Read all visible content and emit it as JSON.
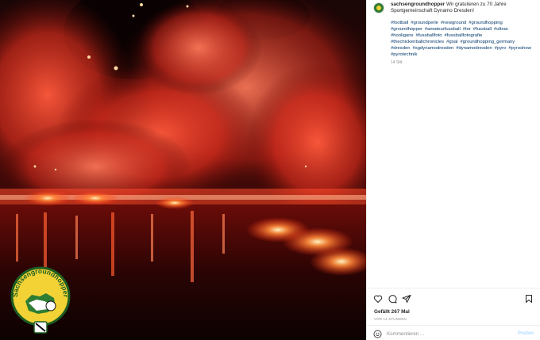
{
  "post": {
    "username": "sachsengroundhopper",
    "caption": "Wir gratulieren zu 70 Jahre Sportgemeinschaft Dynamo Dresden!",
    "hashtags": [
      "#football",
      "#groundperle",
      "#newground",
      "#groundhopping",
      "#groundhopper",
      "#amateurfussball",
      "#tor",
      "#fussball",
      "#ultras",
      "#hooligans",
      "#fussballfoto",
      "#fussballfotografie",
      "#thechickenballchronicles",
      "#goal",
      "#groundhopping_germany",
      "#dresden",
      "#sgdynamodresden",
      "#dynamodresden",
      "#pyro",
      "#pyroshow",
      "#pyrotechnik"
    ],
    "time_ago": "14 Std."
  },
  "media": {
    "badge_text": "Sachsengroundhopper",
    "icon": "pyro-photo"
  },
  "actions": {
    "likes_text": "Gefällt 267 Mal",
    "timestamp": "VOR 14 STUNDEN",
    "like_icon": "heart-icon",
    "comment_icon": "comment-icon",
    "share_icon": "paper-plane-icon",
    "save_icon": "bookmark-icon"
  },
  "comment": {
    "placeholder": "Kommentieren ...",
    "post_label": "Posten"
  },
  "colors": {
    "link": "#00376b",
    "muted": "#8e8e8e",
    "post_button": "#b3dbff",
    "badge_yellow": "#f3d235",
    "badge_green": "#2e7d32"
  }
}
